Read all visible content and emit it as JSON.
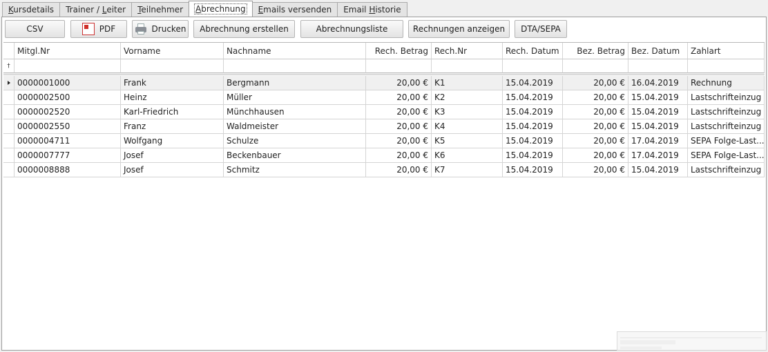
{
  "tabs": [
    {
      "pre": "",
      "key": "K",
      "post": "ursdetails",
      "active": false
    },
    {
      "pre": "Trainer / ",
      "key": "L",
      "post": "eiter",
      "active": false
    },
    {
      "pre": "",
      "key": "T",
      "post": "eilnehmer",
      "active": false
    },
    {
      "pre": "",
      "key": "A",
      "post": "brechnung",
      "active": true
    },
    {
      "pre": "",
      "key": "E",
      "post": "mails versenden",
      "active": false
    },
    {
      "pre": "Email ",
      "key": "H",
      "post": "istorie",
      "active": false
    }
  ],
  "toolbar": {
    "csv": "CSV",
    "pdf": "PDF",
    "print": "Drucken",
    "create_invoice": "Abrechnung erstellen",
    "invoice_list": "Abrechnungsliste",
    "show_invoices": "Rechnungen anzeigen",
    "dta_sepa": "DTA/SEPA"
  },
  "columns": [
    {
      "label": "Mitgl.Nr",
      "align": "left"
    },
    {
      "label": "Vorname",
      "align": "left"
    },
    {
      "label": "Nachname",
      "align": "left"
    },
    {
      "label": "Rech. Betrag",
      "align": "right"
    },
    {
      "label": "Rech.Nr",
      "align": "left"
    },
    {
      "label": "Rech. Datum",
      "align": "left"
    },
    {
      "label": "Bez. Betrag",
      "align": "right"
    },
    {
      "label": "Bez. Datum",
      "align": "left"
    },
    {
      "label": "Zahlart",
      "align": "left"
    }
  ],
  "rows": [
    [
      "0000001000",
      "Frank",
      "Bergmann",
      "20,00 €",
      "K1",
      "15.04.2019",
      "20,00 €",
      "16.04.2019",
      "Rechnung"
    ],
    [
      "0000002500",
      "Heinz",
      "Müller",
      "20,00 €",
      "K2",
      "15.04.2019",
      "20,00 €",
      "15.04.2019",
      "Lastschrifteinzug"
    ],
    [
      "0000002520",
      "Karl-Friedrich",
      "Münchhausen",
      "20,00 €",
      "K3",
      "15.04.2019",
      "20,00 €",
      "15.04.2019",
      "Lastschrifteinzug"
    ],
    [
      "0000002550",
      "Franz",
      "Waldmeister",
      "20,00 €",
      "K4",
      "15.04.2019",
      "20,00 €",
      "15.04.2019",
      "Lastschrifteinzug"
    ],
    [
      "0000004711",
      "Wolfgang",
      "Schulze",
      "20,00 €",
      "K5",
      "15.04.2019",
      "20,00 €",
      "17.04.2019",
      "SEPA Folge-Last..."
    ],
    [
      "0000007777",
      "Josef",
      "Beckenbauer",
      "20,00 €",
      "K6",
      "15.04.2019",
      "20,00 €",
      "17.04.2019",
      "SEPA Folge-Last..."
    ],
    [
      "0000008888",
      "Josef",
      "Schmitz",
      "20,00 €",
      "K7",
      "15.04.2019",
      "20,00 €",
      "15.04.2019",
      "Lastschrifteinzug"
    ]
  ],
  "selected_row": 0,
  "icons": {
    "filter_row": "filter-pin-icon",
    "current_row": "row-pointer-icon",
    "pdf": "pdf-icon",
    "print": "printer-icon"
  }
}
